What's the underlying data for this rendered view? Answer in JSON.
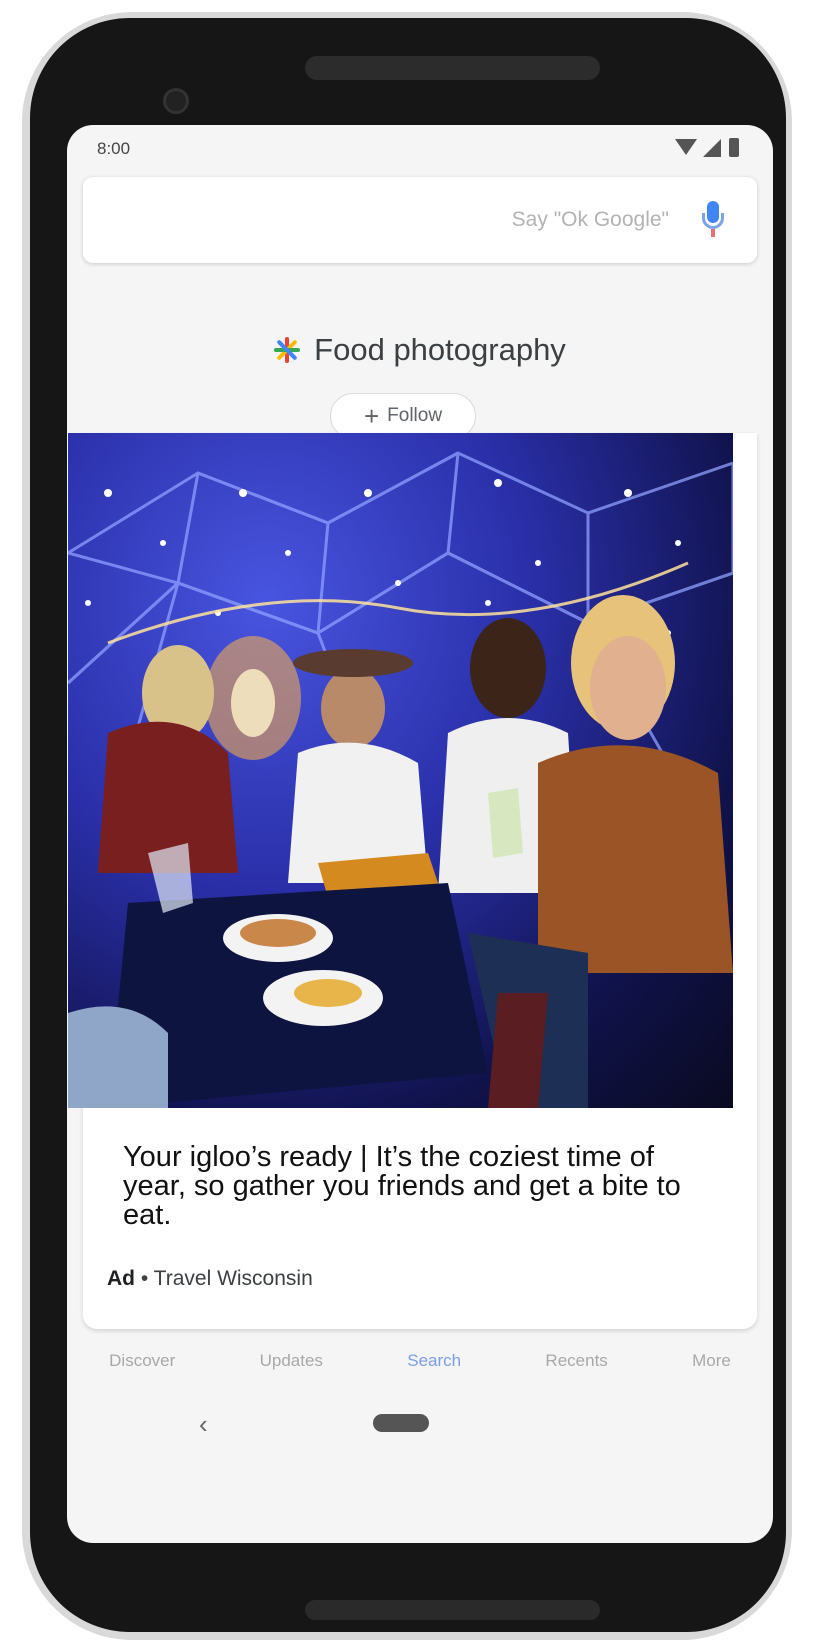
{
  "status_bar": {
    "time": "8:00",
    "icons": [
      "wifi-icon",
      "signal-icon",
      "battery-icon"
    ]
  },
  "search": {
    "placeholder": "Say \"Ok Google\"",
    "icon": "mic-icon"
  },
  "topic": {
    "title": "Food photography",
    "icon": "sparkle-icon",
    "follow_label": "Follow"
  },
  "card": {
    "image_description": "people-in-igloo-photo",
    "headline": "Your igloo’s ready | It’s the coziest time of year, so gather you friends and get a bite to eat.",
    "ad_label": "Ad",
    "separator": "•",
    "advertiser": "Travel Wisconsin"
  },
  "bottom_nav": {
    "items": [
      "Discover",
      "Updates",
      "Search",
      "Recents",
      "More"
    ],
    "active_index": 2
  },
  "system_nav": {
    "back_glyph": "‹"
  },
  "colors": {
    "accent": "#4285f4",
    "active_tab": "#7a9ee8"
  }
}
